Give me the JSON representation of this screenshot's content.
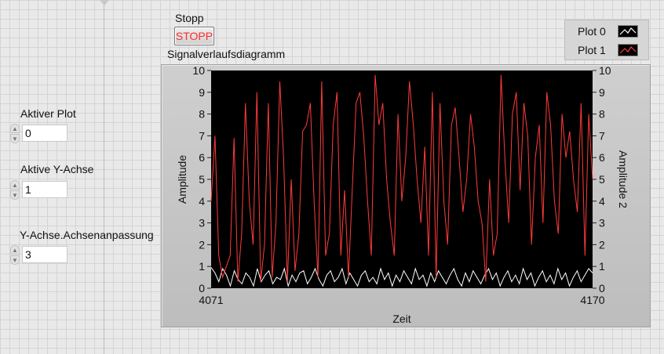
{
  "controls": {
    "stop": {
      "label": "Stopp",
      "button_text": "STOPP",
      "button_text_color": "#ff2a2a"
    },
    "active_plot": {
      "label": "Aktiver Plot",
      "value": "0"
    },
    "active_y_axis": {
      "label": "Aktive Y-Achse",
      "value": "1"
    },
    "y_axis_fit": {
      "label": "Y-Achse.Achsenanpassung",
      "value": "3"
    }
  },
  "legend": {
    "items": [
      {
        "label": "Plot 0",
        "color": "#ffffff"
      },
      {
        "label": "Plot 1",
        "color": "#ff3b3b"
      }
    ]
  },
  "graph": {
    "title": "Signalverlaufsdiagramm",
    "x_axis_label": "Zeit",
    "x_min_label": "4071",
    "x_max_label": "4170",
    "y_left_label": "Amplitude",
    "y_right_label": "Amplitude 2",
    "y_ticks": [
      "0",
      "1",
      "2",
      "3",
      "4",
      "5",
      "6",
      "7",
      "8",
      "9",
      "10"
    ]
  },
  "chart_data": {
    "type": "line",
    "title": "Signalverlaufsdiagramm",
    "xlabel": "Zeit",
    "ylabel": "Amplitude",
    "ylabel_right": "Amplitude 2",
    "xlim": [
      4071,
      4170
    ],
    "ylim": [
      0,
      10
    ],
    "ylim_right": [
      0,
      10
    ],
    "grid": false,
    "legend_position": "top-right",
    "series": [
      {
        "name": "Plot 0",
        "color": "#ffffff",
        "axis": "left",
        "values": [
          0.95,
          0.7,
          0.3,
          0.9,
          0.6,
          0.1,
          0.8,
          0.4,
          0.2,
          0.7,
          0.5,
          0.1,
          0.9,
          0.3,
          0.6,
          0.8,
          0.2,
          0.5,
          0.4,
          0.9,
          0.1,
          0.6,
          0.3,
          0.7,
          0.8,
          0.2,
          0.5,
          0.9,
          0.4,
          0.1,
          0.6,
          0.8,
          0.3,
          0.5,
          0.9,
          0.2,
          0.7,
          0.4,
          0.1,
          0.6,
          0.8,
          0.3,
          0.5,
          0.2,
          0.9,
          0.4,
          0.7,
          0.1,
          0.6,
          0.3,
          0.8,
          0.5,
          0.2,
          0.9,
          0.4,
          0.6,
          0.1,
          0.7,
          0.3,
          0.8,
          0.5,
          0.2,
          0.6,
          0.9,
          0.4,
          0.1,
          0.7,
          0.3,
          0.8,
          0.5,
          0.2,
          0.6,
          0.9,
          0.4,
          0.7,
          0.1,
          0.5,
          0.8,
          0.3,
          0.6,
          0.2,
          0.9,
          0.4,
          0.7,
          0.1,
          0.5,
          0.8,
          0.3,
          0.6,
          0.2,
          0.9,
          0.4,
          0.7,
          0.1,
          0.5,
          0.8,
          0.3,
          0.6,
          0.9,
          0.7
        ]
      },
      {
        "name": "Plot 1",
        "color": "#ff3b3b",
        "axis": "right",
        "values": [
          4,
          7,
          1.5,
          0.5,
          1,
          1.5,
          6.9,
          0.3,
          2.5,
          8.5,
          4,
          2,
          9,
          0.3,
          2,
          8.5,
          0.5,
          3,
          9.5,
          6,
          0.3,
          5,
          0.8,
          2.5,
          7.2,
          7.5,
          8.5,
          4,
          0.5,
          9.5,
          1.5,
          2.5,
          7.5,
          9,
          1.5,
          4.5,
          0.5,
          4.5,
          8.5,
          9,
          7,
          4,
          1.5,
          9.8,
          7.5,
          8.5,
          5,
          3,
          1.5,
          8,
          4,
          6,
          9.5,
          7.5,
          5,
          3,
          6.5,
          1.5,
          9,
          0.5,
          8.5,
          4,
          2,
          7.5,
          8.3,
          6,
          3.5,
          5,
          8,
          6.5,
          4,
          3,
          0.3,
          5,
          1.5,
          2.5,
          9.8,
          6,
          3,
          8,
          9,
          4.5,
          8.5,
          7,
          2,
          6,
          7.5,
          3,
          9,
          7.5,
          4,
          2.5,
          8,
          6,
          7.2,
          5,
          3.5,
          8.5,
          1.5,
          8,
          5
        ]
      }
    ]
  }
}
